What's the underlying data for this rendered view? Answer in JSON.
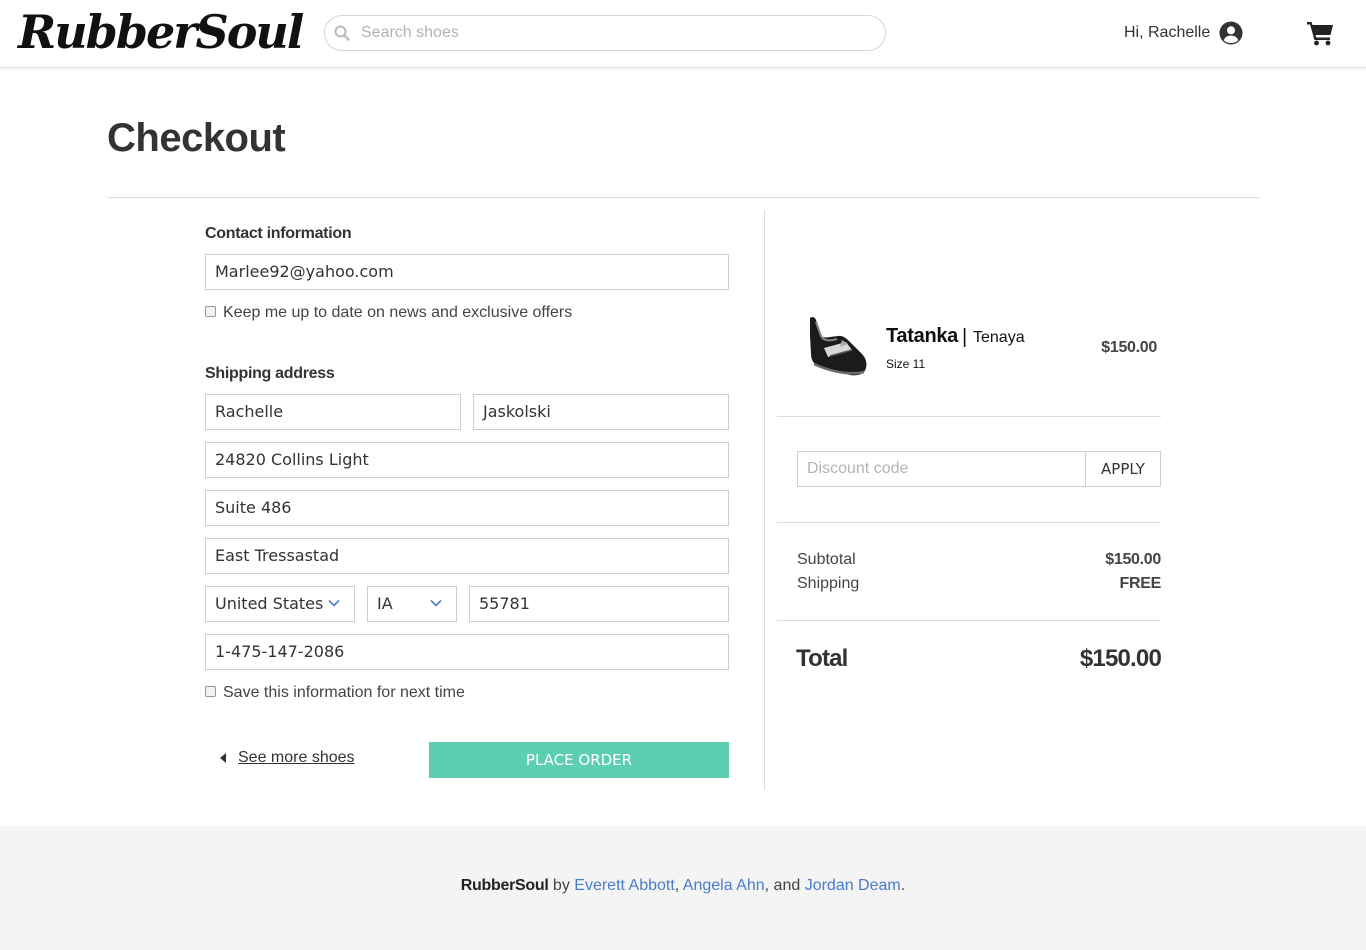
{
  "header": {
    "logo": "RubberSoul",
    "search_placeholder": "Search shoes",
    "greeting": "Hi, Rachelle"
  },
  "page": {
    "title": "Checkout"
  },
  "contact": {
    "heading": "Contact information",
    "email": "Marlee92@yahoo.com",
    "newsletter_label": "Keep me up to date on news and exclusive offers"
  },
  "shipping": {
    "heading": "Shipping address",
    "first_name": "Rachelle",
    "last_name": "Jaskolski",
    "address1": "24820 Collins Light",
    "address2": "Suite 486",
    "city": "East Tressastad",
    "country": "United States",
    "state": "IA",
    "zip": "55781",
    "phone": "1-475-147-2086",
    "save_label": "Save this information for next time"
  },
  "actions": {
    "back_label": "See more shoes",
    "place_order_label": "PLACE ORDER"
  },
  "summary": {
    "product": {
      "name": "Tatanka",
      "separator": "|",
      "brand": "Tenaya",
      "size": "Size 11",
      "price": "$150.00"
    },
    "discount_placeholder": "Discount code",
    "apply_label": "APPLY",
    "subtotal_label": "Subtotal",
    "subtotal_value": "$150.00",
    "shipping_label": "Shipping",
    "shipping_value": "FREE",
    "total_label": "Total",
    "total_value": "$150.00"
  },
  "footer": {
    "brand": "RubberSoul",
    "by": " by ",
    "author1": "Everett Abbott",
    "comma1": ", ",
    "author2": "Angela Ahn",
    "and": ", and ",
    "author3": "Jordan Deam",
    "period": "."
  },
  "colors": {
    "accent": "#5ccfb2",
    "link": "#4a7cc9",
    "footer_bg": "#f4f4f4"
  },
  "icons": [
    "search-icon",
    "user-icon",
    "cart-icon",
    "chevron-down-icon",
    "caret-left-icon"
  ]
}
